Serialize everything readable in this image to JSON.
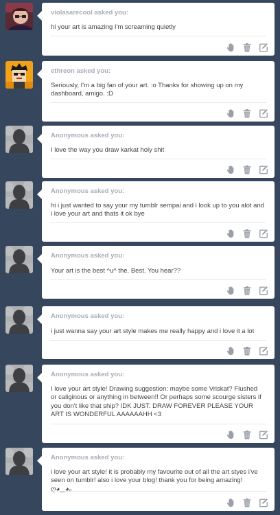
{
  "colors": {
    "background": "#36465d",
    "card": "#ffffff",
    "asker_text": "#a7adb5",
    "message_text": "#444444",
    "icon": "#9aa0a8"
  },
  "asks": [
    {
      "asker": "violasarecool asked you:",
      "message": "hi your art is amazing I'm screaming quietly",
      "avatar": "photo-avatar"
    },
    {
      "asker": "ethreon asked you:",
      "message": "Seriously, I'm a big fan of your art. :o Thanks for showing up on my dashboard, amigo. :D",
      "avatar": "pixel-avatar"
    },
    {
      "asker": "Anonymous asked you:",
      "message": "I love the way you draw karkat holy shit",
      "avatar": "anonymous-avatar"
    },
    {
      "asker": "Anonymous asked you:",
      "message": "hi i just wanted to say your my tumblr sempai and i look up to you alot and i love your art and thats it ok bye",
      "avatar": "anonymous-avatar"
    },
    {
      "asker": "Anonymous asked you:",
      "message": "Your art is the best ^u^ the. Best. You hear??",
      "avatar": "anonymous-avatar"
    },
    {
      "asker": "Anonymous asked you:",
      "message": "i just wanna say your art style makes me really happy and i love it a lot",
      "avatar": "anonymous-avatar"
    },
    {
      "asker": "Anonymous asked you:",
      "message": "I love your art style! Drawing suggestion: maybe some Vriskat? Flushed or caliginous or anything in between!! Or perhaps some scourge sisters if you don't like that ship? IDK JUST. DRAW FOREVER PLEASE YOUR ART IS WONDERFUL AAAAAAHH <3",
      "avatar": "anonymous-avatar"
    },
    {
      "asker": "Anonymous asked you:",
      "message": "i love your art style! it is probably my favourite out of all the art styes i've seen on tumblr! also i love your blog! thank you for being amazing! ღ◕‿◕｡",
      "avatar": "anonymous-avatar"
    }
  ],
  "action_icons": [
    "answer-hand-icon",
    "delete-trash-icon",
    "edit-pencil-icon"
  ]
}
